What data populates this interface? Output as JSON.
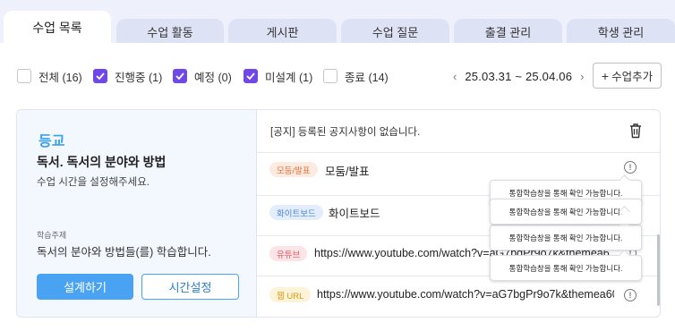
{
  "tabs": [
    {
      "label": "수업 목록",
      "active": true
    },
    {
      "label": "수업 활동",
      "active": false
    },
    {
      "label": "게시판",
      "active": false
    },
    {
      "label": "수업 질문",
      "active": false
    },
    {
      "label": "출결 관리",
      "active": false
    },
    {
      "label": "학생 관리",
      "active": false
    }
  ],
  "filters": [
    {
      "label": "전체 (16)",
      "checked": false
    },
    {
      "label": "진행중 (1)",
      "checked": true
    },
    {
      "label": "예정 (0)",
      "checked": true
    },
    {
      "label": "미설계 (1)",
      "checked": true
    },
    {
      "label": "종료 (14)",
      "checked": false
    }
  ],
  "date_nav": {
    "prev": "‹",
    "range": "25.03.31 ~ 25.04.06",
    "next": "›"
  },
  "add_button": {
    "plus": "+",
    "label": "수업추가"
  },
  "card": {
    "subject": "등교",
    "title": "독서. 독서의 분야와 방법",
    "hint": "수업 시간을 설정해주세요.",
    "goal_label": "학습주제",
    "goal_text": "독서의 분야와 방법들(를) 학습합니다.",
    "primary_button": "설계하기",
    "secondary_button": "시간설정",
    "notice": "[공지] 등록된 공지사항이 없습니다.",
    "activities": [
      {
        "badge": "모둠/발표",
        "title": "모둠/발표",
        "badge_bg": "#fdebe2",
        "badge_color": "#e0743c"
      },
      {
        "badge": "화이트보드",
        "title": "화이트보드",
        "badge_bg": "#e4edfb",
        "badge_color": "#4a86d8"
      },
      {
        "badge": "유튜브",
        "title": "https://www.youtube.com/watch?v=aG7bgPr9o7k&themea6001t9...",
        "badge_bg": "#fde4e6",
        "badge_color": "#e05a64"
      },
      {
        "badge": "웹 URL",
        "title": "https://www.youtube.com/watch?v=aG7bgPr9o7k&themea6001...",
        "badge_bg": "#fdf3d8",
        "badge_color": "#d69a12"
      }
    ],
    "tooltips": [
      "통합학습창을 통해 확인 가능합니다.",
      "통합학습창을 통해 확인 가능합니다.",
      "통합학습창을 통해 확인 가능합니다.",
      "통합학습창을 통해 확인 가능합니다."
    ]
  },
  "colors": {
    "accent": "#7048e8",
    "primary": "#4aa3f2",
    "subject": "#3aa0f0"
  },
  "icons": {
    "trash": "trash-icon",
    "info": "info-icon",
    "checkbox": "check-icon",
    "chevrons": "chevron-icon"
  }
}
